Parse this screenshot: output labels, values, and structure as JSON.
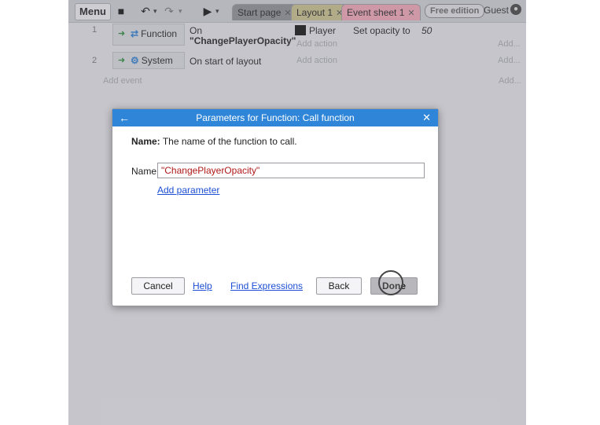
{
  "toolbar": {
    "menu_label": "Menu",
    "save_icon": "floppy-icon",
    "undo_icon": "undo-icon",
    "redo_icon": "redo-icon",
    "play_icon": "play-icon",
    "tabs": [
      {
        "label": "Start page",
        "color": "#8e8e94"
      },
      {
        "label": "Layout 1",
        "color": "#c9c08a"
      },
      {
        "label": "Event sheet 1",
        "color": "#f2a6b6"
      }
    ],
    "edition_badge": "Free edition",
    "user_label": "Guest"
  },
  "events": [
    {
      "number": "1",
      "condition_object": "Function",
      "condition_text_line1": "On",
      "condition_text_line2": "\"ChangePlayerOpacity\"",
      "action_object": "Player",
      "action_text": "Set opacity to",
      "action_value": "50",
      "add_action": "Add action",
      "add_action_short": "Add..."
    },
    {
      "number": "2",
      "condition_object": "System",
      "condition_text_line1": "On start of layout",
      "add_action": "Add action",
      "add_action_short": "Add..."
    }
  ],
  "add_event": "Add event",
  "add_event_short": "Add...",
  "dialog": {
    "title": "Parameters for Function: Call function",
    "description_bold": "Name:",
    "description_text": "The name of the function to call.",
    "name_label": "Name",
    "name_value": "\"ChangePlayerOpacity\"",
    "add_parameter": "Add parameter",
    "buttons": {
      "cancel": "Cancel",
      "help": "Help",
      "find_expressions": "Find Expressions",
      "back": "Back",
      "done": "Done"
    }
  },
  "colors": {
    "dialog_header": "#2f86d9",
    "link": "#1d4fd6",
    "name_value": "#b01818"
  }
}
